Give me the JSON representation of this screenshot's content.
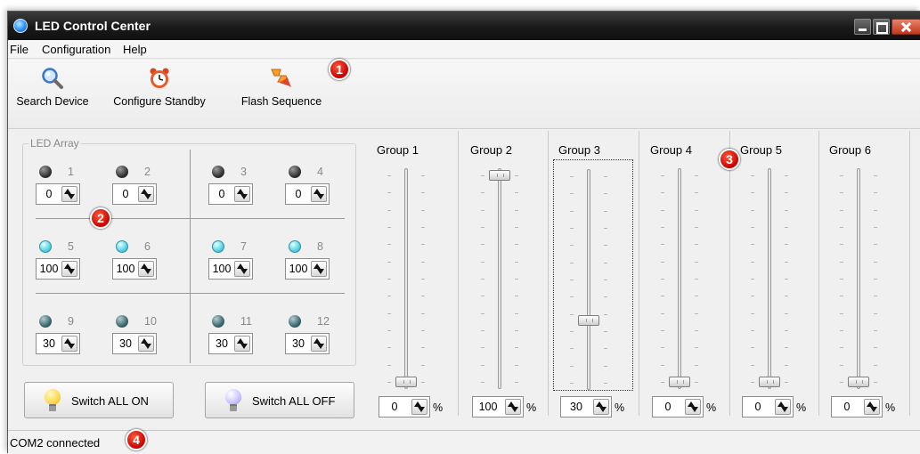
{
  "window": {
    "title": "LED Control Center",
    "accent": "#1a1a1a"
  },
  "menu": [
    "File",
    "Configuration",
    "Help"
  ],
  "toolbar": {
    "search_label": "Search Device",
    "standby_label": "Configure Standby",
    "flash_label": "Flash Sequence"
  },
  "badges": [
    "1",
    "2",
    "3",
    "4"
  ],
  "led_array": {
    "title": "LED Array",
    "leds": [
      {
        "num": "1",
        "value": "0",
        "state": "off"
      },
      {
        "num": "2",
        "value": "0",
        "state": "off"
      },
      {
        "num": "3",
        "value": "0",
        "state": "off"
      },
      {
        "num": "4",
        "value": "0",
        "state": "off"
      },
      {
        "num": "5",
        "value": "100",
        "state": "on"
      },
      {
        "num": "6",
        "value": "100",
        "state": "on"
      },
      {
        "num": "7",
        "value": "100",
        "state": "on"
      },
      {
        "num": "8",
        "value": "100",
        "state": "on"
      },
      {
        "num": "9",
        "value": "30",
        "state": "mid"
      },
      {
        "num": "10",
        "value": "30",
        "state": "mid"
      },
      {
        "num": "11",
        "value": "30",
        "state": "mid"
      },
      {
        "num": "12",
        "value": "30",
        "state": "mid"
      }
    ]
  },
  "buttons": {
    "all_on": "Switch ALL ON",
    "all_off": "Switch ALL OFF"
  },
  "groups": [
    {
      "label": "Group 1",
      "value": "0",
      "unit": "%",
      "level": 0,
      "focused": false
    },
    {
      "label": "Group 2",
      "value": "100",
      "unit": "%",
      "level": 100,
      "focused": false
    },
    {
      "label": "Group 3",
      "value": "30",
      "unit": "%",
      "level": 30,
      "focused": true
    },
    {
      "label": "Group 4",
      "value": "0",
      "unit": "%",
      "level": 0,
      "focused": false
    },
    {
      "label": "Group 5",
      "value": "0",
      "unit": "%",
      "level": 0,
      "focused": false
    },
    {
      "label": "Group 6",
      "value": "0",
      "unit": "%",
      "level": 0,
      "focused": false
    }
  ],
  "status": "COM2 connected",
  "colors": {
    "led_on": "#62d9e9",
    "led_off": "#2c2c2c",
    "badge": "#c80000",
    "bulb_on": "#ffd84a",
    "bulb_off": "#c7c3ff"
  }
}
